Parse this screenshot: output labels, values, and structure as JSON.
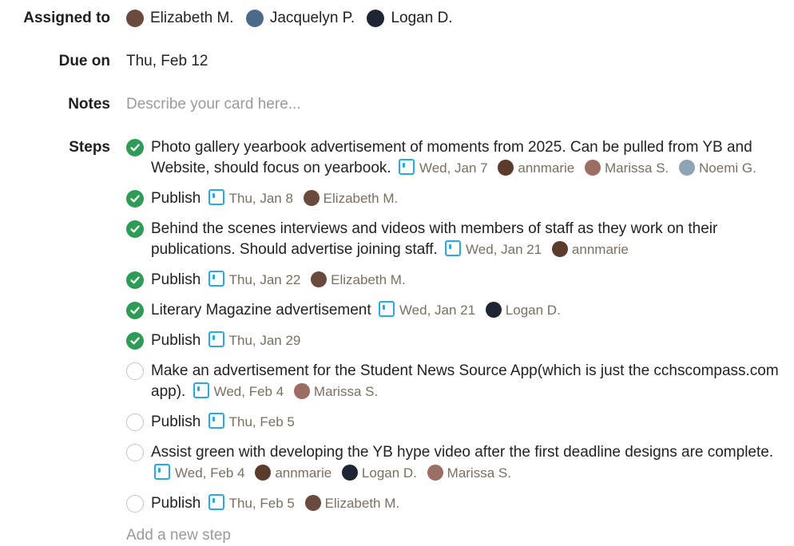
{
  "fields": {
    "assigned_label": "Assigned to",
    "assignees": [
      {
        "name": "Elizabeth M.",
        "avatar_color": "#6a4a3c"
      },
      {
        "name": "Jacquelyn P.",
        "avatar_color": "#4b6a8a"
      },
      {
        "name": "Logan D.",
        "avatar_color": "#1f2633"
      }
    ],
    "due_label": "Due on",
    "due_value": "Thu, Feb 12",
    "notes_label": "Notes",
    "notes_placeholder": "Describe your card here...",
    "steps_label": "Steps"
  },
  "steps": [
    {
      "done": true,
      "text": "Photo gallery yearbook advertisement of moments from 2025. Can be pulled from YB and Website, should focus on yearbook.",
      "date": "Wed, Jan 7",
      "people": [
        {
          "name": "annmarie",
          "avatar_color": "#5a3b2c"
        },
        {
          "name": "Marissa S.",
          "avatar_color": "#9b6d63"
        },
        {
          "name": "Noemi G.",
          "avatar_color": "#8ea3b4"
        }
      ]
    },
    {
      "done": true,
      "text": "Publish",
      "date": "Thu, Jan 8",
      "people": [
        {
          "name": "Elizabeth M.",
          "avatar_color": "#6a4a3c"
        }
      ]
    },
    {
      "done": true,
      "text": "Behind the scenes interviews and videos with members of staff as they work on their publications. Should advertise joining staff.",
      "date": "Wed, Jan 21",
      "people": [
        {
          "name": "annmarie",
          "avatar_color": "#5a3b2c"
        }
      ]
    },
    {
      "done": true,
      "text": "Publish",
      "date": "Thu, Jan 22",
      "people": [
        {
          "name": "Elizabeth M.",
          "avatar_color": "#6a4a3c"
        }
      ]
    },
    {
      "done": true,
      "text": "Literary Magazine advertisement",
      "date": "Wed, Jan 21",
      "people": [
        {
          "name": "Logan D.",
          "avatar_color": "#1f2633"
        }
      ]
    },
    {
      "done": true,
      "text": "Publish",
      "date": "Thu, Jan 29",
      "people": []
    },
    {
      "done": false,
      "text": "Make an advertisement for the Student News Source App(which is just the cchscompass.com app).",
      "date": "Wed, Feb 4",
      "people": [
        {
          "name": "Marissa S.",
          "avatar_color": "#9b6d63"
        }
      ]
    },
    {
      "done": false,
      "text": "Publish",
      "date": "Thu, Feb 5",
      "people": []
    },
    {
      "done": false,
      "text": "Assist green with developing the YB hype video after the first deadline designs are complete.",
      "date": "Wed, Feb 4",
      "people": [
        {
          "name": "annmarie",
          "avatar_color": "#5a3b2c"
        },
        {
          "name": "Logan D.",
          "avatar_color": "#1f2633"
        },
        {
          "name": "Marissa S.",
          "avatar_color": "#9b6d63"
        }
      ]
    },
    {
      "done": false,
      "text": "Publish",
      "date": "Thu, Feb 5",
      "people": [
        {
          "name": "Elizabeth M.",
          "avatar_color": "#6a4a3c"
        }
      ]
    }
  ],
  "add_step_placeholder": "Add a new step",
  "colors": {
    "check_done": "#2e9b57",
    "calendar": "#29a9e0",
    "meta_text": "#7b6f60"
  }
}
